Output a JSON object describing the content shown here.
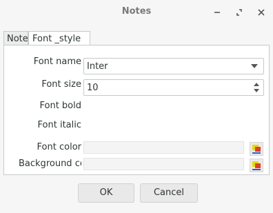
{
  "window": {
    "title": "Notes",
    "controls": [
      "minimize-icon",
      "restore-icon",
      "close-icon"
    ]
  },
  "tabs": [
    {
      "label": "Note",
      "active": false
    },
    {
      "label": "Font _style",
      "active": true
    }
  ],
  "form": {
    "font_name_label": "Font name",
    "font_name_value": "Inter",
    "font_size_label": "Font size",
    "font_size_value": "10",
    "font_bold_label": "Font bold",
    "font_italic_label": "Font italic",
    "font_color_label": "Font color",
    "background_color_label": "Background color"
  },
  "buttons": {
    "ok": "OK",
    "cancel": "Cancel"
  },
  "colors": {
    "title_text": "#7a7a7a",
    "picker_yellow": "#e6d800",
    "picker_red": "#e04020",
    "picker_blue": "#2b5fbf"
  }
}
